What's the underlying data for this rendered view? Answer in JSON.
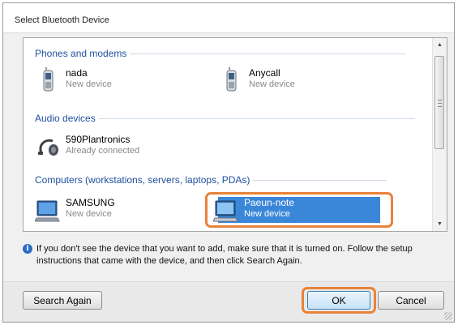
{
  "dialog": {
    "title": "Select Bluetooth Device"
  },
  "groups": {
    "phones": {
      "label": "Phones and modems",
      "devices": [
        {
          "name": "nada",
          "status": "New device",
          "icon": "phone-icon"
        },
        {
          "name": "Anycall",
          "status": "New device",
          "icon": "phone-icon"
        }
      ]
    },
    "audio": {
      "label": "Audio devices",
      "devices": [
        {
          "name": "590Plantronics",
          "status": "Already connected",
          "icon": "headset-icon"
        }
      ]
    },
    "computers": {
      "label": "Computers (workstations, servers, laptops, PDAs)",
      "devices": [
        {
          "name": "SAMSUNG",
          "status": "New device",
          "icon": "computer-icon"
        },
        {
          "name": "Paeun-note",
          "status": "New device",
          "icon": "computer-icon",
          "selected": true
        }
      ]
    }
  },
  "info": {
    "text": "If you don't see the device that you want to add, make sure that it is turned on. Follow the setup instructions that came with the device, and then click Search Again.",
    "icon": "info-icon"
  },
  "buttons": {
    "search_again": "Search Again",
    "ok": "OK",
    "cancel": "Cancel"
  },
  "colors": {
    "accent_highlight": "#e8833a",
    "selection": "#3a86d8",
    "group_header": "#1e4f9e"
  }
}
